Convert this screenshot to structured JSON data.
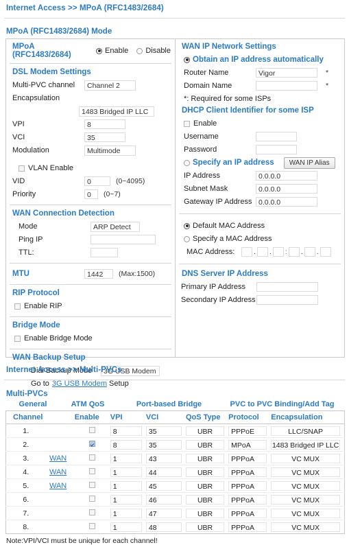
{
  "page1": {
    "breadcrumb": "Internet Access >> MPoA (RFC1483/2684)",
    "section_title": "MPoA (RFC1483/2684) Mode",
    "mode": {
      "label": "MPoA (RFC1483/2684)",
      "enable_label": "Enable",
      "disable_label": "Disable",
      "selected": "Enable"
    },
    "dsl": {
      "title": "DSL Modem Settings",
      "multi_pvc_label": "Multi-PVC channel",
      "multi_pvc_value": "Channel 2",
      "encapsulation_label": "Encapsulation",
      "encapsulation_value": "1483 Bridged IP LLC",
      "vpi_label": "VPI",
      "vpi_value": "8",
      "vci_label": "VCI",
      "vci_value": "35",
      "modulation_label": "Modulation",
      "modulation_value": "Multimode"
    },
    "vlan": {
      "enable_label": "VLAN Enable",
      "enable_checked": false,
      "vid_label": "VID",
      "vid_value": "0",
      "vid_range": "(0~4095)",
      "priority_label": "Priority",
      "priority_value": "0",
      "priority_range": "(0~7)"
    },
    "wan_detect": {
      "title": "WAN Connection Detection",
      "mode_label": "Mode",
      "mode_value": "ARP Detect",
      "ping_label": "Ping IP",
      "ping_value": "",
      "ttl_label": "TTL:",
      "ttl_value": ""
    },
    "mtu": {
      "title": "MTU",
      "value": "1442",
      "max": "(Max:1500)"
    },
    "rip": {
      "title": "RIP Protocol",
      "enable_label": "Enable RIP",
      "enable_checked": false
    },
    "bridge": {
      "title": "Bridge Mode",
      "enable_label": "Enable Bridge Mode",
      "enable_checked": false
    },
    "backup": {
      "title": "WAN Backup Setup",
      "dial_label": "Dial Backup Mode",
      "dial_value": "3G USB Modem",
      "goto_prefix": "Go to",
      "goto_link": "3G USB Modem",
      "goto_suffix": "Setup"
    },
    "wan_ip": {
      "title": "WAN IP Network Settings",
      "obtain_label": "Obtain an IP address automatically",
      "obtain_selected": true,
      "router_name_label": "Router Name",
      "router_name_value": "Vigor",
      "router_name_star": "*",
      "domain_name_label": "Domain Name",
      "domain_name_value": "",
      "domain_name_star": "*",
      "required_note": "*: Required for some ISPs"
    },
    "dhcp": {
      "title": "DHCP Client Identifier for some ISP",
      "enable_label": "Enable",
      "enable_checked": false,
      "username_label": "Username",
      "username_value": "",
      "password_label": "Password",
      "password_value": ""
    },
    "specify_ip": {
      "label": "Specify an IP address",
      "selected": false,
      "alias_button": "WAN IP Alias",
      "ip_label": "IP Address",
      "ip_value": "0.0.0.0",
      "mask_label": "Subnet Mask",
      "mask_value": "0.0.0.0",
      "gw_label": "Gateway IP Address",
      "gw_value": "0.0.0.0"
    },
    "mac": {
      "default_label": "Default MAC Address",
      "specify_label": "Specify a MAC Address",
      "selected": "Default MAC Address",
      "mac_label": "MAC Address:",
      "octets": [
        "",
        "",
        "",
        "",
        "",
        ""
      ],
      "sep1": ".",
      "sep2": ".",
      "sep3": ":",
      "sep4": ".",
      "sep5": "."
    },
    "dns": {
      "title": "DNS Server IP Address",
      "primary_label": "Primary IP Address",
      "primary_value": "",
      "secondary_label": "Secondary IP Address",
      "secondary_value": ""
    }
  },
  "page2": {
    "breadcrumb": "Internet Access >> Multi-PVCs",
    "title": "Multi-PVCs",
    "tabs": [
      "General",
      "ATM QoS",
      "Port-based Bridge",
      "PVC to PVC Binding/Add Tag"
    ],
    "headers": [
      "Channel",
      "Enable",
      "VPI",
      "VCI",
      "QoS Type",
      "Protocol",
      "Encapsulation"
    ],
    "rows": [
      {
        "channel": "1.",
        "wan": "",
        "enabled": false,
        "vpi": "8",
        "vci": "35",
        "qos": "UBR",
        "protocol": "PPPoE",
        "encap": "LLC/SNAP"
      },
      {
        "channel": "2.",
        "wan": "",
        "enabled": true,
        "vpi": "8",
        "vci": "35",
        "qos": "UBR",
        "protocol": "MPoA",
        "encap": "1483 Bridged IP LLC"
      },
      {
        "channel": "3.",
        "wan": "WAN",
        "enabled": false,
        "vpi": "1",
        "vci": "43",
        "qos": "UBR",
        "protocol": "PPPoA",
        "encap": "VC MUX"
      },
      {
        "channel": "4.",
        "wan": "WAN",
        "enabled": false,
        "vpi": "1",
        "vci": "44",
        "qos": "UBR",
        "protocol": "PPPoA",
        "encap": "VC MUX"
      },
      {
        "channel": "5.",
        "wan": "WAN",
        "enabled": false,
        "vpi": "1",
        "vci": "45",
        "qos": "UBR",
        "protocol": "PPPoA",
        "encap": "VC MUX"
      },
      {
        "channel": "6.",
        "wan": "",
        "enabled": false,
        "vpi": "1",
        "vci": "46",
        "qos": "UBR",
        "protocol": "PPPoA",
        "encap": "VC MUX"
      },
      {
        "channel": "7.",
        "wan": "",
        "enabled": false,
        "vpi": "1",
        "vci": "47",
        "qos": "UBR",
        "protocol": "PPPoA",
        "encap": "VC MUX"
      },
      {
        "channel": "8.",
        "wan": "",
        "enabled": false,
        "vpi": "1",
        "vci": "48",
        "qos": "UBR",
        "protocol": "PPPoA",
        "encap": "VC MUX"
      }
    ],
    "note": "Note:VPI/VCI must be unique for each channel!"
  },
  "colors": {
    "accent": "#2b7bc4",
    "border": "#c9c9c9",
    "text": "#1a1a1a"
  }
}
